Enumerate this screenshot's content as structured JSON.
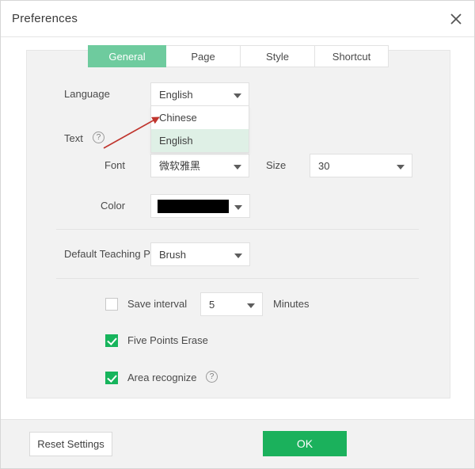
{
  "window": {
    "title": "Preferences",
    "close_icon": "close-icon"
  },
  "tabs": [
    {
      "label": "General",
      "active": true
    },
    {
      "label": "Page",
      "active": false
    },
    {
      "label": "Style",
      "active": false
    },
    {
      "label": "Shortcut",
      "active": false
    }
  ],
  "form": {
    "language": {
      "label": "Language",
      "value": "English",
      "open": true,
      "options": [
        {
          "label": "Chinese",
          "selected": false
        },
        {
          "label": "English",
          "selected": true
        }
      ]
    },
    "text_section": {
      "label": "Text",
      "help_icon": "help-icon",
      "help_glyph": "?"
    },
    "font": {
      "label": "Font",
      "value": "微软雅黑"
    },
    "size": {
      "label": "Size",
      "value": "30"
    },
    "color": {
      "label": "Color",
      "value": "#000000"
    },
    "teaching": {
      "label": "Default Teaching P",
      "value": "Brush"
    },
    "save_interval": {
      "label": "Save interval",
      "checked": false,
      "value": "5",
      "unit": "Minutes"
    },
    "five_points_erase": {
      "label": "Five Points Erase",
      "checked": true
    },
    "area_recognize": {
      "label": "Area recognize",
      "checked": true,
      "help_glyph": "?"
    }
  },
  "footer": {
    "reset_label": "Reset Settings",
    "ok_label": "OK"
  },
  "colors": {
    "accent_green": "#1bb15c",
    "tab_active_green": "#6ecb9e",
    "dropdown_highlight": "#dff0e6",
    "annotation_red": "#d0342c"
  }
}
